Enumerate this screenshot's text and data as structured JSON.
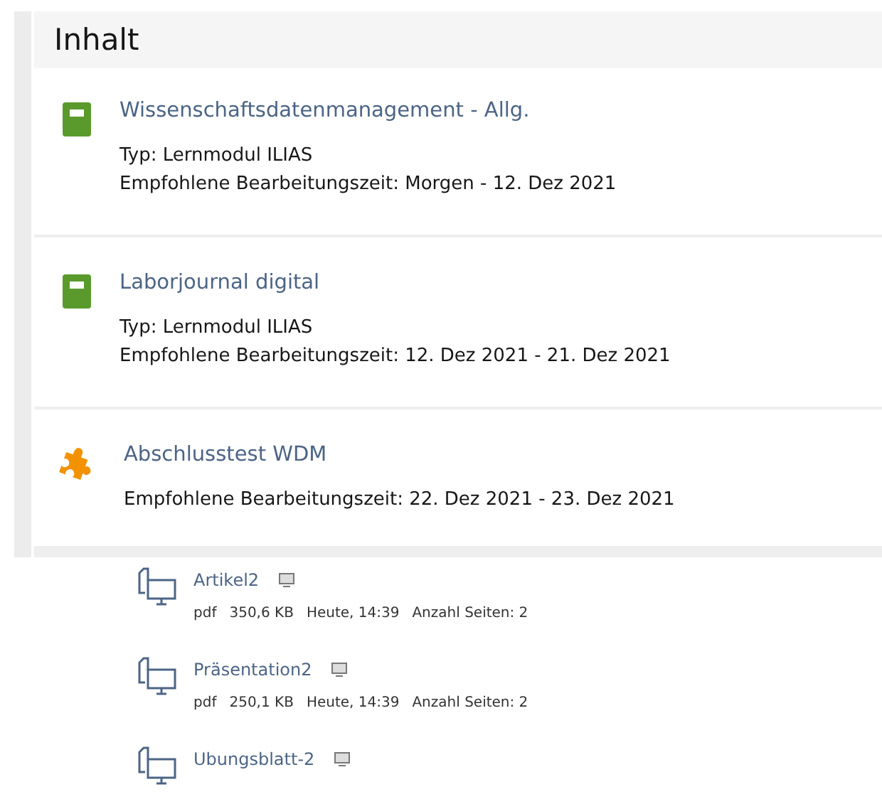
{
  "panel": {
    "title": "Inhalt",
    "items": [
      {
        "kind": "module",
        "title": "Wissenschaftsdatenmanagement - Allg.",
        "lines": [
          "Typ: Lernmodul ILIAS",
          "Empfohlene Bearbeitungszeit: Morgen - 12. Dez 2021"
        ]
      },
      {
        "kind": "module",
        "title": "Laborjournal digital",
        "lines": [
          "Typ: Lernmodul ILIAS",
          "Empfohlene Bearbeitungszeit: 12. Dez 2021 - 21. Dez 2021"
        ]
      },
      {
        "kind": "test",
        "title": "Abschlusstest WDM",
        "lines": [
          "Empfohlene Bearbeitungszeit: 22. Dez 2021 - 23. Dez 2021"
        ]
      }
    ]
  },
  "files": [
    {
      "title": "Artikel2",
      "properties": [
        "pdf",
        "350,6 KB",
        "Heute, 14:39",
        "Anzahl Seiten: 2"
      ]
    },
    {
      "title": "Präsentation2",
      "properties": [
        "pdf",
        "250,1 KB",
        "Heute, 14:39",
        "Anzahl Seiten: 2"
      ]
    },
    {
      "title": "Ubungsblatt-2"
    }
  ]
}
